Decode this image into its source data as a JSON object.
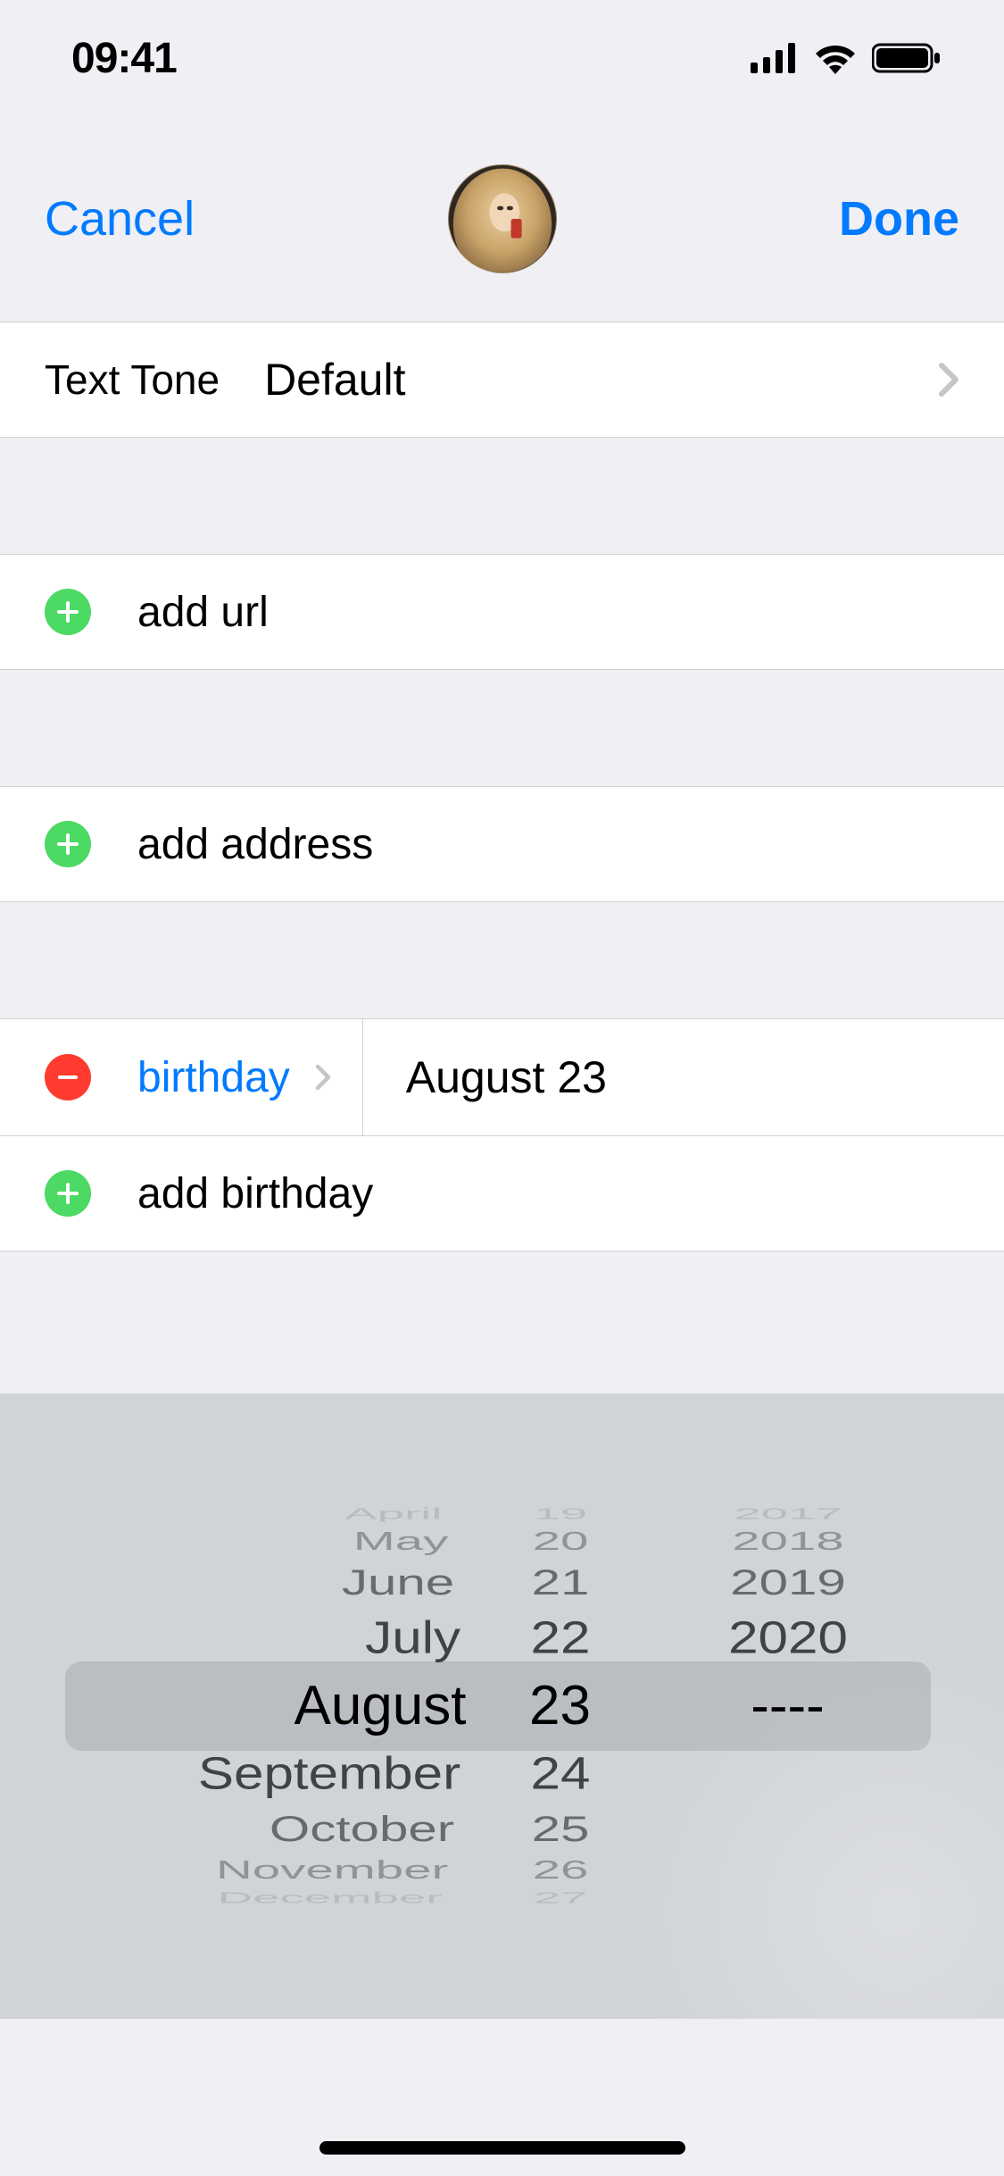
{
  "status": {
    "time": "09:41"
  },
  "nav": {
    "cancel_label": "Cancel",
    "done_label": "Done"
  },
  "text_tone": {
    "label": "Text Tone",
    "value": "Default"
  },
  "add_url": {
    "label": "add url"
  },
  "add_address": {
    "label": "add address"
  },
  "birthday": {
    "field_label": "birthday",
    "value_display": "August 23",
    "add_label": "add birthday"
  },
  "picker": {
    "months": [
      "April",
      "May",
      "June",
      "July",
      "August",
      "September",
      "October",
      "November",
      "December"
    ],
    "days": [
      "19",
      "20",
      "21",
      "22",
      "23",
      "24",
      "25",
      "26",
      "27"
    ],
    "years": [
      "2017",
      "2018",
      "2019",
      "2020",
      "----",
      "",
      "",
      "",
      ""
    ],
    "selected_index": 4,
    "selected": {
      "month": "August",
      "day": "23",
      "year": "----"
    }
  }
}
